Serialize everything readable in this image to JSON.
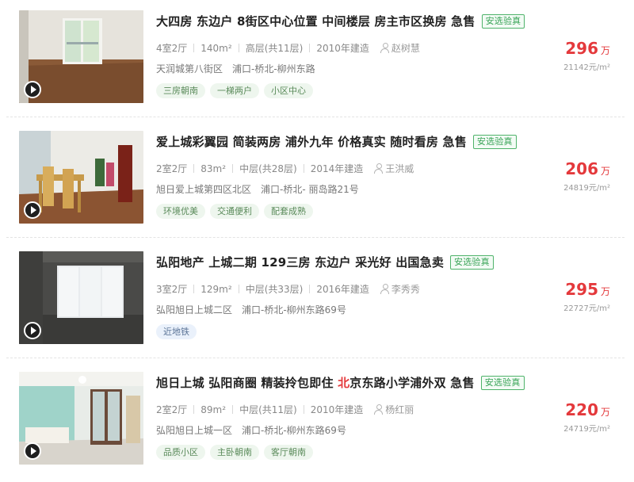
{
  "listings": [
    {
      "title": "大四房 东边户 8街区中心位置 中间楼层 房主市区换房 急售",
      "title_parts": [
        "大四房 东边户 8街区中心位置 中间楼层 房主市区换房 急售"
      ],
      "badge": "安选验真",
      "layout": "4室2厅",
      "area": "140m²",
      "floor": "高层(共11层)",
      "year": "2010年建造",
      "agent": "赵树慧",
      "community": "天润城第八街区",
      "district": "浦口-桥北-柳州东路",
      "tags": [
        "三房朝南",
        "一梯两户",
        "小区中心"
      ],
      "price": "296",
      "price_unit": "万",
      "unit_price": "21142元/m²"
    },
    {
      "title": "爱上城彩翼园 简装两房 浦外九年 价格真实 随时看房 急售",
      "badge": "安选验真",
      "layout": "2室2厅",
      "area": "83m²",
      "floor": "中层(共28层)",
      "year": "2014年建造",
      "agent": "王洪威",
      "community": "旭日爱上城第四区北区",
      "district": "浦口-桥北- 丽岛路21号",
      "tags": [
        "环境优美",
        "交通便利",
        "配套成熟"
      ],
      "price": "206",
      "price_unit": "万",
      "unit_price": "24819元/m²"
    },
    {
      "title": "弘阳地产 上城二期 129三房 东边户 采光好 出国急卖",
      "badge": "安选验真",
      "layout": "3室2厅",
      "area": "129m²",
      "floor": "中层(共33层)",
      "year": "2016年建造",
      "agent": "李秀秀",
      "community": "弘阳旭日上城二区",
      "district": "浦口-桥北-柳州东路69号",
      "tags": [
        "近地铁"
      ],
      "price": "295",
      "price_unit": "万",
      "unit_price": "22727元/m²"
    },
    {
      "title_a": "旭日上城 弘阳商圈 精装拎包即住 ",
      "title_red": "北",
      "title_b": "京东路小学浦外双 急售",
      "badge": "安选验真",
      "layout": "2室2厅",
      "area": "89m²",
      "floor": "中层(共11层)",
      "year": "2010年建造",
      "agent": "杨红丽",
      "community": "弘阳旭日上城一区",
      "district": "浦口-桥北-柳州东路69号",
      "tags": [
        "品质小区",
        "主卧朝南",
        "客厅朝南"
      ],
      "price": "220",
      "price_unit": "万",
      "unit_price": "24719元/m²"
    }
  ],
  "colors": {
    "price": "#e4393c",
    "badge": "#3aa458",
    "tag_green_bg": "#eef6ee",
    "tag_blue_bg": "#eaf1fb"
  },
  "icons": {
    "play": "play-icon",
    "agent": "person-icon"
  }
}
